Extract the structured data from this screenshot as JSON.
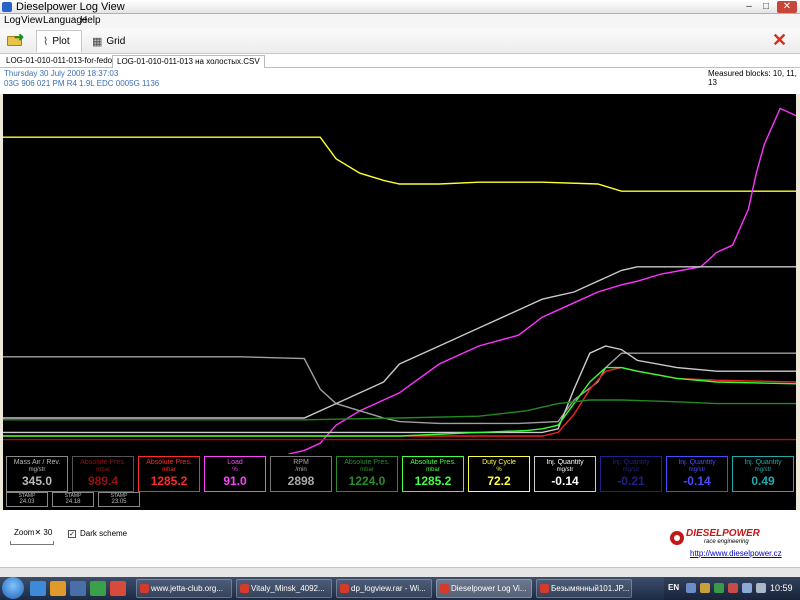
{
  "window": {
    "title": "Dieselpower Log View",
    "min": "–",
    "max": "□",
    "close": "✕"
  },
  "menu": [
    "Log",
    "View",
    "Language",
    "Help"
  ],
  "toolbar": {
    "plot_label": "Plot",
    "grid_label": "Grid",
    "close_label": "✕"
  },
  "file_tabs": [
    "LOG-01-010-011-013-for-fedor.CSV",
    "LOG-01-010-011-013 на холостых.CSV"
  ],
  "info": {
    "date": "Thursday 30 July 2009 18:37:03",
    "ecu": "03G 906 021 PM  R4 1.9L EDC  0005G  1136",
    "measured_blocks": "Measured blocks: 10, 11, 13"
  },
  "chart_data": {
    "type": "line",
    "ylim": [
      0,
      100
    ],
    "grid": false,
    "background": "#000000",
    "series": [
      {
        "color": "#ffff33",
        "x": [
          0,
          40,
          42,
          45,
          48,
          50,
          55,
          60,
          68,
          75,
          78,
          85,
          100
        ],
        "y": [
          88,
          88,
          82,
          78,
          76,
          75,
          75,
          75.5,
          75.5,
          75,
          73,
          73,
          73
        ]
      },
      {
        "color": "#ff33ff",
        "x": [
          36,
          38,
          40,
          42,
          45,
          48,
          50,
          55,
          60,
          65,
          68,
          72,
          75,
          78,
          80,
          83,
          88,
          90,
          92,
          94,
          95,
          96,
          98,
          100
        ],
        "y": [
          0,
          1,
          3,
          8,
          12,
          15,
          17,
          25,
          30,
          33,
          38,
          42,
          45,
          47,
          48,
          50,
          52,
          56,
          58,
          68,
          78,
          86,
          96,
          94
        ]
      },
      {
        "color": "#a0a0a0",
        "x": [
          0,
          10,
          20,
          30,
          38,
          40,
          42,
          45,
          48,
          50,
          55,
          60,
          65,
          70,
          72,
          75,
          76,
          78,
          80,
          100
        ],
        "y": [
          27,
          27,
          27,
          27,
          26.5,
          18,
          14,
          12,
          10,
          9,
          8.5,
          8.5,
          8.5,
          9,
          15,
          20,
          24,
          28,
          28,
          28
        ]
      },
      {
        "color": "#c8c8c8",
        "x": [
          0,
          38,
          42,
          48,
          50,
          55,
          60,
          65,
          68,
          70,
          72,
          74,
          75,
          76,
          77,
          78,
          80,
          85,
          90,
          100
        ],
        "y": [
          10,
          10,
          14,
          20,
          25,
          30,
          35,
          40,
          43,
          44,
          45,
          47,
          48,
          49,
          50,
          51,
          52,
          52,
          52,
          52
        ]
      },
      {
        "color": "#cccccc",
        "x": [
          0,
          68,
          70,
          72,
          74,
          76,
          78,
          80,
          85,
          90,
          100
        ],
        "y": [
          6,
          6,
          7,
          18,
          28,
          30,
          29,
          26,
          24,
          23,
          23
        ]
      },
      {
        "color": "#ee2222",
        "x": [
          0,
          68,
          70,
          72,
          74,
          76,
          78,
          80,
          85,
          90,
          100
        ],
        "y": [
          5,
          5,
          6,
          11,
          18,
          23,
          24,
          23,
          21,
          20.5,
          20
        ]
      },
      {
        "color": "#33ff33",
        "x": [
          0,
          38,
          50,
          60,
          66,
          68,
          70,
          72,
          74,
          76,
          78,
          80,
          85,
          90,
          100
        ],
        "y": [
          5,
          5,
          5,
          6,
          6.5,
          7,
          8,
          14,
          20,
          24,
          24,
          23,
          21,
          20,
          19.5
        ]
      },
      {
        "color": "#228822",
        "x": [
          0,
          38,
          50,
          60,
          66,
          68,
          70,
          74,
          78,
          85,
          90,
          100
        ],
        "y": [
          9.5,
          9.5,
          10,
          10.5,
          12,
          13,
          14,
          15,
          15,
          14.5,
          14,
          14
        ]
      },
      {
        "color": "#aa1111",
        "x": [
          0,
          100
        ],
        "y": [
          4,
          4
        ]
      }
    ]
  },
  "gauges": [
    {
      "name": "Mass Air / Rev.",
      "unit": "mg/str",
      "value": "345.0",
      "color": "#bbbbbb",
      "border": "#888888"
    },
    {
      "name": "Absolute Pres.",
      "unit": "mbar",
      "value": "989.4",
      "color": "#991111",
      "border": "#555555"
    },
    {
      "name": "Absolute Pres.",
      "unit": "mbar",
      "value": "1285.2",
      "color": "#ff2a2a",
      "border": "#ff2a2a"
    },
    {
      "name": "Load",
      "unit": "%",
      "value": "91.0",
      "color": "#ff44ff",
      "border": "#ff44ff"
    },
    {
      "name": "RPM",
      "unit": "/min",
      "value": "2898",
      "color": "#aaaaaa",
      "border": "#777777"
    },
    {
      "name": "Absolute Pres.",
      "unit": "mbar",
      "value": "1224.0",
      "color": "#2a8c2a",
      "border": "#2a8c2a"
    },
    {
      "name": "Absolute Pres.",
      "unit": "mbar",
      "value": "1285.2",
      "color": "#44ff44",
      "border": "#44ff44"
    },
    {
      "name": "Duty Cycle",
      "unit": "%",
      "value": "72.2",
      "color": "#ffff44",
      "border": "#ffff44"
    },
    {
      "name": "Inj. Quantity",
      "unit": "mg/str",
      "value": "-0.14",
      "color": "#ffffff",
      "border": "#cccccc"
    },
    {
      "name": "Inj. Quantity",
      "unit": "mg/str",
      "value": "-0.21",
      "color": "#20208a",
      "border": "#20208a"
    },
    {
      "name": "Inj. Quantity",
      "unit": "mg/str",
      "value": "-0.14",
      "color": "#4a4aff",
      "border": "#4a4aff"
    },
    {
      "name": "Inj. Quantity",
      "unit": "mg/str",
      "value": "0.49",
      "color": "#22aaaa",
      "border": "#22aaaa"
    }
  ],
  "stamps": [
    {
      "label": "STAMP",
      "value": "24.03"
    },
    {
      "label": "STAMP",
      "value": "24.18"
    },
    {
      "label": "STAMP",
      "value": "23.05"
    }
  ],
  "controls": {
    "zoom_label": "Zoom",
    "zoom_value": "30",
    "dark_scheme_label": "Dark scheme",
    "dark_scheme_checked": "✓",
    "brand": "DIESELPOWER",
    "brand_sub": "race engineering",
    "website": "http://www.dieselpower.cz"
  },
  "taskbar": {
    "tasks": [
      "www.jetta-club.org...",
      "Vitaly_Minsk_4092...",
      "dp_logview.rar - Wi...",
      "Dieselpower Log Vi...",
      "Безымянный101.JP..."
    ],
    "active_task": 3,
    "lang": "EN",
    "clock": "10:59"
  }
}
